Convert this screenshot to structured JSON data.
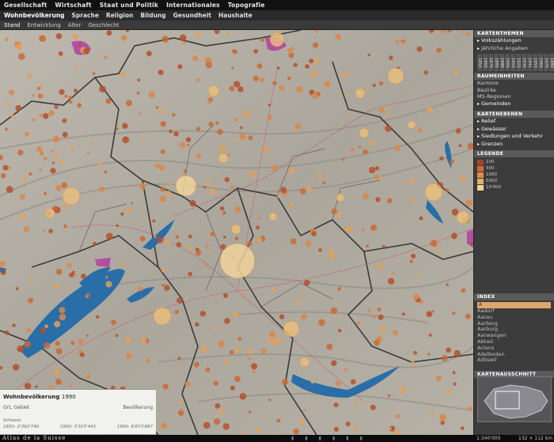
{
  "nav": {
    "level1": [
      "Gesellschaft",
      "Wirtschaft",
      "Staat und Politik",
      "Internationales",
      "Topografie"
    ],
    "level2": [
      "Wohnbevölkerung",
      "Sprache",
      "Religion",
      "Bildung",
      "Gesundheit",
      "Haushalte"
    ],
    "level3": [
      "Stand",
      "Entwicklung",
      "Alter",
      "Geschlecht"
    ]
  },
  "panel": {
    "kartenthemen_title": "KARTENTHEMEN",
    "kartenthemen": [
      "Volkszählungen",
      "Jährliche Angaben"
    ],
    "years": [
      "1850",
      "1860",
      "1870",
      "1880",
      "1888",
      "1900",
      "1910",
      "1920",
      "1930",
      "1941",
      "1950",
      "1960",
      "1970",
      "1980",
      "1990",
      "2000"
    ],
    "selected_year": "1990",
    "raumeinheiten_title": "RAUMEINHEITEN",
    "raumeinheiten": [
      "Kantone",
      "Bezirke",
      "MS-Regionen",
      "Gemeinden"
    ],
    "kartenebenen_title": "KARTENEBENEN",
    "kartenebenen": [
      "Relief",
      "Gewässer",
      "Siedlungen und Verkehr",
      "Grenzen"
    ],
    "legende_title": "LEGENDE",
    "legend": [
      {
        "label": "100",
        "color": "#a5432a"
      },
      {
        "label": "500",
        "color": "#cc6b3a"
      },
      {
        "label": "1000",
        "color": "#dd8f4c"
      },
      {
        "label": "5000",
        "color": "#e5b06a"
      },
      {
        "label": "10'000",
        "color": "#f0d39a"
      }
    ],
    "index_title": "INDEX",
    "index_query": "A",
    "index_items": [
      "Aadorf",
      "Aarau",
      "Aarberg",
      "Aarburg",
      "Aarwangen",
      "Abtwil",
      "Aclens",
      "Adelboden",
      "Adliswil"
    ],
    "kartenausschnitt_title": "KARTENAUSSCHNITT"
  },
  "infobox": {
    "title": "Wohnbevölkerung",
    "year": "1990",
    "col1": "Ort, Gebiet",
    "col2": "Bevölkerung",
    "scope": "Schweiz",
    "values": [
      "1850: 2'392'740",
      "1900: 3'315'443",
      "1990: 6'873'687"
    ]
  },
  "footer": {
    "brand": "Atlas de la Suisse",
    "scale": "1:340'000",
    "dimensions": "132 × 112 km"
  },
  "colors": {
    "lake": "#2a6ea8",
    "dot": "#c86a35",
    "urban": "#b23fa0",
    "relief": "#b3aea4"
  }
}
